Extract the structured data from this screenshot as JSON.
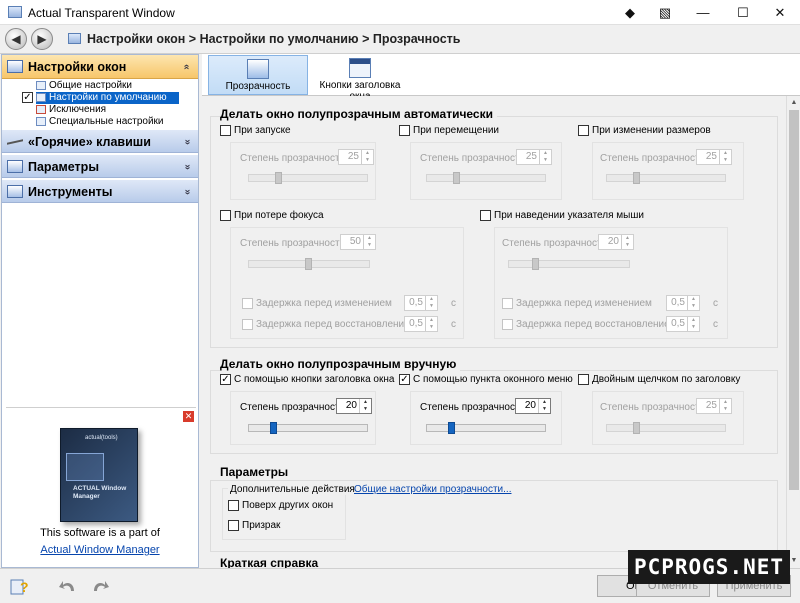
{
  "window": {
    "title": "Actual Transparent Window",
    "controls": {
      "pin": "◆",
      "special": "▧",
      "minimize": "—",
      "maximize": "☐",
      "close": "✕"
    }
  },
  "nav": {
    "back": "◀",
    "forward": "▶",
    "breadcrumb": "Настройки окон > Настройки по умолчанию > Прозрачность"
  },
  "sidebar": {
    "sections": [
      {
        "label": "Настройки окон",
        "chevron": "»",
        "icon": "windows-settings-icon"
      },
      {
        "label": "«Горячие» клавиши",
        "chevron": "»",
        "icon": "hotkeys-icon"
      },
      {
        "label": "Параметры",
        "chevron": "»",
        "icon": "options-icon"
      },
      {
        "label": "Инструменты",
        "chevron": "»",
        "icon": "tools-icon"
      }
    ],
    "tree": [
      {
        "label": "Общие настройки"
      },
      {
        "label": "Настройки по умолчанию",
        "checkmark": "✓"
      },
      {
        "label": "Исключения"
      },
      {
        "label": "Специальные настройки"
      }
    ],
    "promo": {
      "close": "✕",
      "text": "This software is a part of",
      "link": "Actual Window Manager",
      "box_top": "actual(tools)",
      "box_name": "ACTUAL Window Manager"
    }
  },
  "tabs": [
    {
      "label": "Прозрачность"
    },
    {
      "label": "Кнопки заголовка окна"
    }
  ],
  "auto": {
    "title": "Делать окно полупрозрачным автоматически",
    "spin_label": "Степень прозрачности",
    "on_start": {
      "label": "При запуске",
      "value": "25"
    },
    "on_move": {
      "label": "При перемещении",
      "value": "25"
    },
    "on_resize": {
      "label": "При изменении размеров",
      "value": "25"
    },
    "on_focus_loss": {
      "label": "При потере фокуса",
      "value": "50",
      "delay_label": "Задержка перед изменением",
      "delay_value": "0,5",
      "restore_label": "Задержка перед восстановлением",
      "restore_value": "0,5",
      "unit": "с"
    },
    "on_hover": {
      "label": "При наведении указателя мыши",
      "value": "20",
      "delay_label": "Задержка перед изменением",
      "delay_value": "0,5",
      "restore_label": "Задержка перед восстановлением",
      "restore_value": "0,5",
      "unit": "с"
    }
  },
  "manual": {
    "title": "Делать окно полупрозрачным вручную",
    "spin_label": "Степень прозрачности",
    "by_title_button": {
      "label": "С помощью кнопки заголовка окна",
      "checkmark": "✓",
      "value": "20"
    },
    "by_menu_item": {
      "label": "С помощью пункта оконного меню",
      "checkmark": "✓",
      "value": "20"
    },
    "by_double_click": {
      "label": "Двойным щелчком по заголовку",
      "value": "25"
    }
  },
  "params": {
    "title": "Параметры",
    "extra_actions": "Дополнительные действия",
    "always_on_top": "Поверх других окон",
    "ghost": "Призрак",
    "general_link": "Общие настройки прозрачности..."
  },
  "brief": {
    "title": "Краткая справка"
  },
  "spinner": {
    "up": "▲",
    "down": "▼"
  },
  "scroll": {
    "up": "▲",
    "down": "▼"
  },
  "footer": {
    "ok": "OK",
    "cancel": "Отменить",
    "apply": "Применить"
  },
  "watermark": "PCPROGS.NET"
}
